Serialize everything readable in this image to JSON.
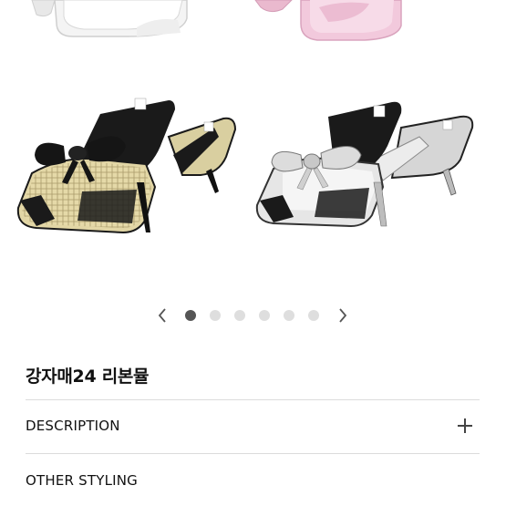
{
  "product": {
    "title": "강자매24 리본뮬"
  },
  "carousel": {
    "dot_count": 6,
    "active_index": 0
  },
  "accordion": [
    {
      "label": "DESCRIPTION",
      "icon": "plus-icon"
    },
    {
      "label": "OTHER STYLING",
      "icon": "plus-icon"
    }
  ],
  "colors": {
    "dot_active": "#555555",
    "dot_inactive": "#dedede",
    "divider": "#dcdcdc"
  }
}
